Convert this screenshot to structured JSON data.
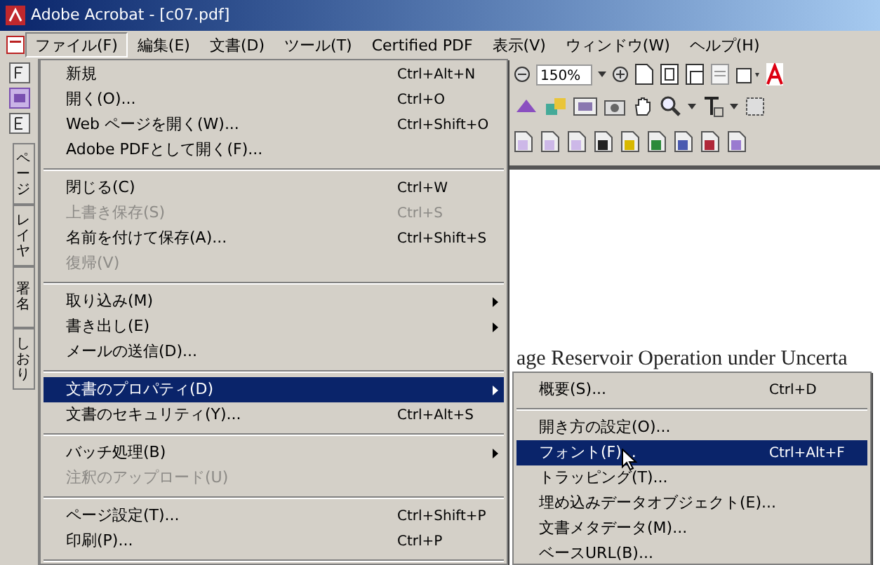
{
  "window": {
    "title": "Adobe Acrobat - [c07.pdf]"
  },
  "menu_bar": [
    {
      "label": "ファイル(F)",
      "selected": true
    },
    {
      "label": "編集(E)",
      "selected": false
    },
    {
      "label": "文書(D)",
      "selected": false
    },
    {
      "label": "ツール(T)",
      "selected": false
    },
    {
      "label": "Certified PDF",
      "selected": false
    },
    {
      "label": "表示(V)",
      "selected": false
    },
    {
      "label": "ウィンドウ(W)",
      "selected": false
    },
    {
      "label": "ヘルプ(H)",
      "selected": false
    }
  ],
  "toolbar": {
    "zoom": "150%"
  },
  "navigation_tabs": [
    {
      "label": "ページ"
    },
    {
      "label": "レイヤ"
    },
    {
      "label": "署名"
    },
    {
      "label": "しおり"
    }
  ],
  "document": {
    "text": "age Reservoir Operation under Uncerta"
  },
  "file_menu": [
    {
      "kind": "item",
      "label": "新規",
      "shortcut": "Ctrl+Alt+N",
      "disabled": false,
      "submenu": false,
      "selected": false
    },
    {
      "kind": "item",
      "label": "開く(O)...",
      "shortcut": "Ctrl+O",
      "disabled": false,
      "submenu": false,
      "selected": false
    },
    {
      "kind": "item",
      "label": "Web ページを開く(W)...",
      "shortcut": "Ctrl+Shift+O",
      "disabled": false,
      "submenu": false,
      "selected": false
    },
    {
      "kind": "item",
      "label": "Adobe PDFとして開く(F)...",
      "disabled": false,
      "submenu": false,
      "selected": false
    },
    {
      "kind": "separator"
    },
    {
      "kind": "item",
      "label": "閉じる(C)",
      "shortcut": "Ctrl+W",
      "disabled": false,
      "submenu": false,
      "selected": false
    },
    {
      "kind": "item",
      "label": "上書き保存(S)",
      "shortcut": "Ctrl+S",
      "disabled": true,
      "submenu": false,
      "selected": false
    },
    {
      "kind": "item",
      "label": "名前を付けて保存(A)...",
      "shortcut": "Ctrl+Shift+S",
      "disabled": false,
      "submenu": false,
      "selected": false
    },
    {
      "kind": "item",
      "label": "復帰(V)",
      "disabled": true,
      "submenu": false,
      "selected": false
    },
    {
      "kind": "separator"
    },
    {
      "kind": "item",
      "label": "取り込み(M)",
      "disabled": false,
      "submenu": true,
      "selected": false
    },
    {
      "kind": "item",
      "label": "書き出し(E)",
      "disabled": false,
      "submenu": true,
      "selected": false
    },
    {
      "kind": "item",
      "label": "メールの送信(D)...",
      "disabled": false,
      "submenu": false,
      "selected": false
    },
    {
      "kind": "separator"
    },
    {
      "kind": "item",
      "label": "文書のプロパティ(D)",
      "disabled": false,
      "submenu": true,
      "selected": true
    },
    {
      "kind": "item",
      "label": "文書のセキュリティ(Y)...",
      "shortcut": "Ctrl+Alt+S",
      "disabled": false,
      "submenu": false,
      "selected": false
    },
    {
      "kind": "separator"
    },
    {
      "kind": "item",
      "label": "バッチ処理(B)",
      "disabled": false,
      "submenu": true,
      "selected": false
    },
    {
      "kind": "item",
      "label": "注釈のアップロード(U)",
      "disabled": true,
      "submenu": false,
      "selected": false
    },
    {
      "kind": "separator"
    },
    {
      "kind": "item",
      "label": "ページ設定(T)...",
      "shortcut": "Ctrl+Shift+P",
      "disabled": false,
      "submenu": false,
      "selected": false
    },
    {
      "kind": "item",
      "label": "印刷(P)...",
      "shortcut": "Ctrl+P",
      "disabled": false,
      "submenu": false,
      "selected": false
    },
    {
      "kind": "separator"
    }
  ],
  "properties_submenu": [
    {
      "kind": "item",
      "label": "概要(S)...",
      "shortcut": "Ctrl+D",
      "selected": false
    },
    {
      "kind": "separator"
    },
    {
      "kind": "item",
      "label": "開き方の設定(O)...",
      "selected": false
    },
    {
      "kind": "item",
      "label": "フォント(F)...",
      "shortcut": "Ctrl+Alt+F",
      "selected": true
    },
    {
      "kind": "item",
      "label": "トラッピング(T)...",
      "selected": false
    },
    {
      "kind": "item",
      "label": "埋め込みデータオブジェクト(E)...",
      "selected": false
    },
    {
      "kind": "item",
      "label": "文書メタデータ(M)...",
      "selected": false
    },
    {
      "kind": "item",
      "label": "ベースURL(B)...",
      "selected": false
    }
  ]
}
